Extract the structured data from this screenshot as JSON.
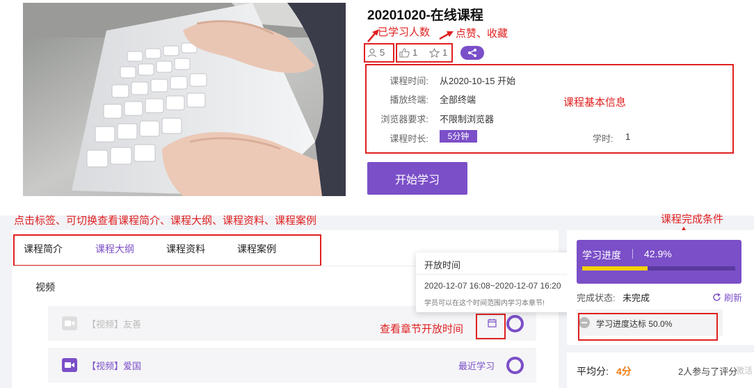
{
  "course": {
    "title": "20201020-在线课程",
    "learners": "5",
    "likes": "1",
    "favorites": "1",
    "start_button": "开始学习"
  },
  "info": {
    "time_label": "课程时间:",
    "time_value": "从2020-10-15 开始",
    "terminal_label": "播放终端:",
    "terminal_value": "全部终端",
    "browser_label": "浏览器要求:",
    "browser_value": "不限制浏览器",
    "duration_label": "课程时长:",
    "duration_value": "5分钟",
    "credit_label": "学时:",
    "credit_value": "1"
  },
  "annotations": {
    "learners_note": "已学习人数",
    "like_fav_note": "点赞、收藏",
    "basic_info_note": "课程基本信息",
    "tabs_note": "点击标签、可切换查看课程简介、课程大纲、课程资料、课程案例",
    "completion_note": "课程完成条件",
    "chapter_time_note": "查看章节开放时间"
  },
  "tabs": [
    "课程简介",
    "课程大纲",
    "课程资料",
    "课程案例"
  ],
  "outline": {
    "section": "视频",
    "chapters": [
      {
        "text": "【视频】友善"
      },
      {
        "text": "【视频】爱国",
        "status": "最近学习"
      }
    ]
  },
  "popup": {
    "title": "开放时间",
    "time": "2020-12-07 16:08~2020-12-07 16:20",
    "desc": "学员可以在这个时间范围内学习本章节!"
  },
  "progress": {
    "label": "学习进度",
    "percent_text": "42.9%",
    "fraction": 0.429,
    "status_label": "完成状态:",
    "status_value": "未完成",
    "refresh": "刷新",
    "condition": "学习进度达标 50.0%"
  },
  "rating": {
    "avg_label": "平均分:",
    "avg_value": "4分",
    "participants": "2人参与了评分"
  },
  "watermark": "激活"
}
